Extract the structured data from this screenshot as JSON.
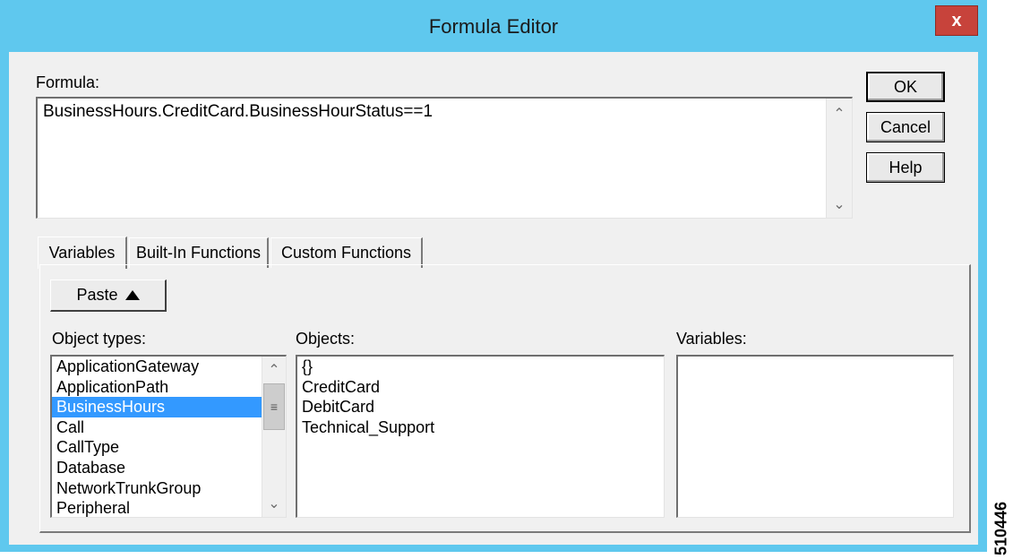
{
  "window": {
    "title": "Formula Editor",
    "close_label": "x"
  },
  "formula": {
    "label": "Formula:",
    "value": "BusinessHours.CreditCard.BusinessHourStatus==1"
  },
  "buttons": {
    "ok": "OK",
    "cancel": "Cancel",
    "help": "Help"
  },
  "tabs": [
    {
      "label": "Variables",
      "active": true
    },
    {
      "label": "Built-In Functions",
      "active": false
    },
    {
      "label": "Custom Functions",
      "active": false
    }
  ],
  "paste": {
    "label": "Paste",
    "icon": "triangle-up-icon"
  },
  "object_types": {
    "label": "Object types:",
    "selected": "BusinessHours",
    "items": [
      "ApplicationGateway",
      "ApplicationPath",
      "BusinessHours",
      "Call",
      "CallType",
      "Database",
      "NetworkTrunkGroup",
      "Peripheral"
    ]
  },
  "objects": {
    "label": "Objects:",
    "items": [
      "{}",
      "CreditCard",
      "DebitCard",
      "Technical_Support"
    ]
  },
  "variables": {
    "label": "Variables:",
    "items": []
  },
  "figure_id": "510446",
  "colors": {
    "titlebar": "#5fc8ee",
    "close": "#c7433b",
    "selection": "#3399ff",
    "dialog": "#f0f0f0"
  }
}
